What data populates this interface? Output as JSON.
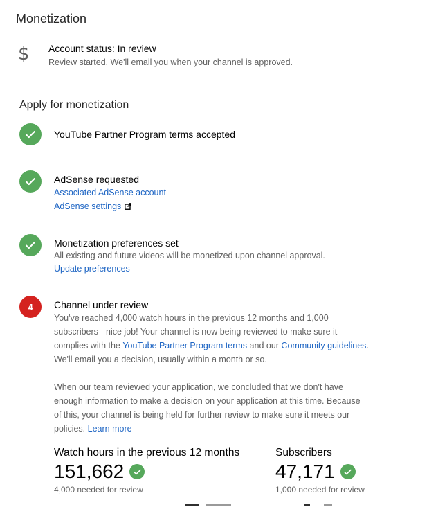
{
  "page_title": "Monetization",
  "account_status": {
    "icon": "dollar-icon",
    "title": "Account status: In review",
    "subtitle": "Review started. We'll email you when your channel is approved."
  },
  "section_title": "Apply for monetization",
  "steps": [
    {
      "state": "done",
      "title": "YouTube Partner Program terms accepted"
    },
    {
      "state": "done",
      "title": "AdSense requested",
      "links": [
        "Associated AdSense account",
        "AdSense settings"
      ]
    },
    {
      "state": "done",
      "title": "Monetization preferences set",
      "text": "All existing and future videos will be monetized upon channel approval.",
      "link": "Update preferences"
    },
    {
      "state": "number",
      "number": "4",
      "title": "Channel under review",
      "para1": {
        "line1": "You've reached 4,000 watch hours in the previous 12 months and 1,000",
        "line2": "subscribers - nice job! Your channel is now being reviewed to make sure it",
        "line3_pre": "complies with the ",
        "line3_link1": "YouTube Partner Program terms",
        "line3_mid": " and our ",
        "line3_link2": "Community guidelines",
        "line3_post": ".",
        "line4": "We'll email you a decision, usually within a month or so."
      },
      "para2": {
        "line1": "When our team reviewed your application, we concluded that we don't have",
        "line2": "enough information to make a decision on your application at this time. Because",
        "line3": "of this, your channel is being held for further review to make sure it meets our",
        "line4_pre": "policies. ",
        "line4_link": "Learn more"
      }
    }
  ],
  "stats": [
    {
      "label": "Watch hours in the previous 12 months",
      "value": "151,662",
      "sub": "4,000 needed for review"
    },
    {
      "label": "Subscribers",
      "value": "47,171",
      "sub": "1,000 needed for review"
    }
  ],
  "colors": {
    "check_green": "#56a85b",
    "step_red": "#d4221f",
    "link_blue": "#1f66c4",
    "secondary_text": "#606060"
  }
}
